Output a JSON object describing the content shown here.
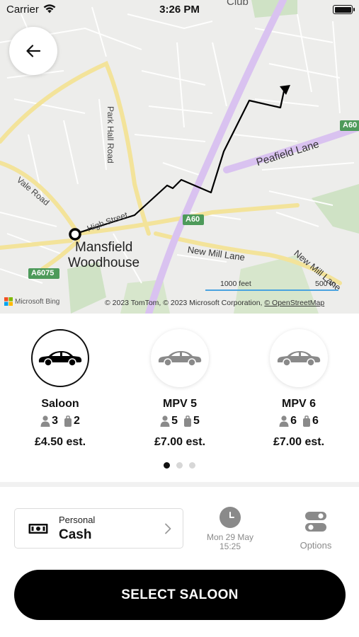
{
  "status_bar": {
    "carrier": "Carrier",
    "time": "3:26 PM"
  },
  "map": {
    "labels": {
      "club": "Club",
      "park_hall_road": "Park Hall Road",
      "vale_road": "Vale Road",
      "high_street": "High Street",
      "a60": "A60",
      "a60_right": "A60",
      "peafield_lane": "Peafield Lane",
      "mansfield": "Mansfield",
      "woodhouse": "Woodhouse",
      "new_mill_lane": "New Mill Lane",
      "new_mill_lane_2": "New Mill Lane",
      "a6075": "A6075"
    },
    "scale_feet": "1000 feet",
    "scale_m": "500 m",
    "attribution": "© 2023 TomTom, © 2023 Microsoft Corporation, ",
    "attribution_link": "© OpenStreetMap",
    "bing": "Microsoft Bing",
    "route_color": "#000000",
    "main_road_color": "#d9c2f0"
  },
  "vehicles": [
    {
      "name": "Saloon",
      "passengers": "3",
      "luggage": "2",
      "price": "£4.50 est.",
      "selected": true
    },
    {
      "name": "MPV 5",
      "passengers": "5",
      "luggage": "5",
      "price": "£7.00 est.",
      "selected": false
    },
    {
      "name": "MPV 6",
      "passengers": "6",
      "luggage": "6",
      "price": "£7.00 est.",
      "selected": false
    }
  ],
  "pager": {
    "pages": 3,
    "active": 0
  },
  "payment": {
    "account": "Personal",
    "method": "Cash"
  },
  "schedule": {
    "date": "Mon 29 May",
    "time": "15:25"
  },
  "options": {
    "label": "Options"
  },
  "cta": {
    "label": "SELECT SALOON"
  },
  "icons": {
    "back": "arrow-left-icon",
    "car": "car-icon",
    "passenger": "person-icon",
    "luggage": "suitcase-icon",
    "cash": "banknote-icon",
    "chevron": "chevron-right-icon",
    "clock": "clock-icon",
    "options": "toggle-options-icon"
  }
}
